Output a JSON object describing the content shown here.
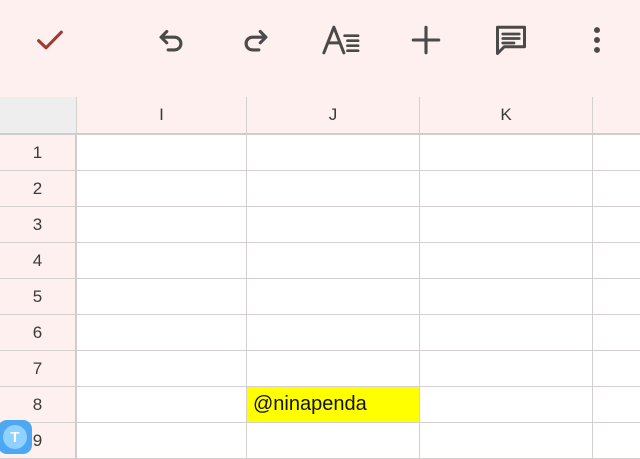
{
  "toolbar": {
    "icons": [
      "check-icon",
      "undo-icon",
      "redo-icon",
      "text-format-icon",
      "add-icon",
      "comment-icon",
      "more-vert-icon"
    ],
    "icon_color": "#4a4a4a",
    "accent_color": "#a0392f",
    "background": "#fdf0ef"
  },
  "sheet": {
    "columns": [
      "I",
      "J",
      "K"
    ],
    "rows": [
      "1",
      "2",
      "3",
      "4",
      "5",
      "6",
      "7",
      "8",
      "9"
    ],
    "cells": [
      {
        "col": "J",
        "row": "8",
        "value": "@ninapenda",
        "fill": "#ffff00"
      }
    ],
    "header_background": "#fdf0ef",
    "gridline_color": "#d4d0cf"
  },
  "floating_button": {
    "label": "T",
    "icon": "translate-bubble-icon"
  }
}
